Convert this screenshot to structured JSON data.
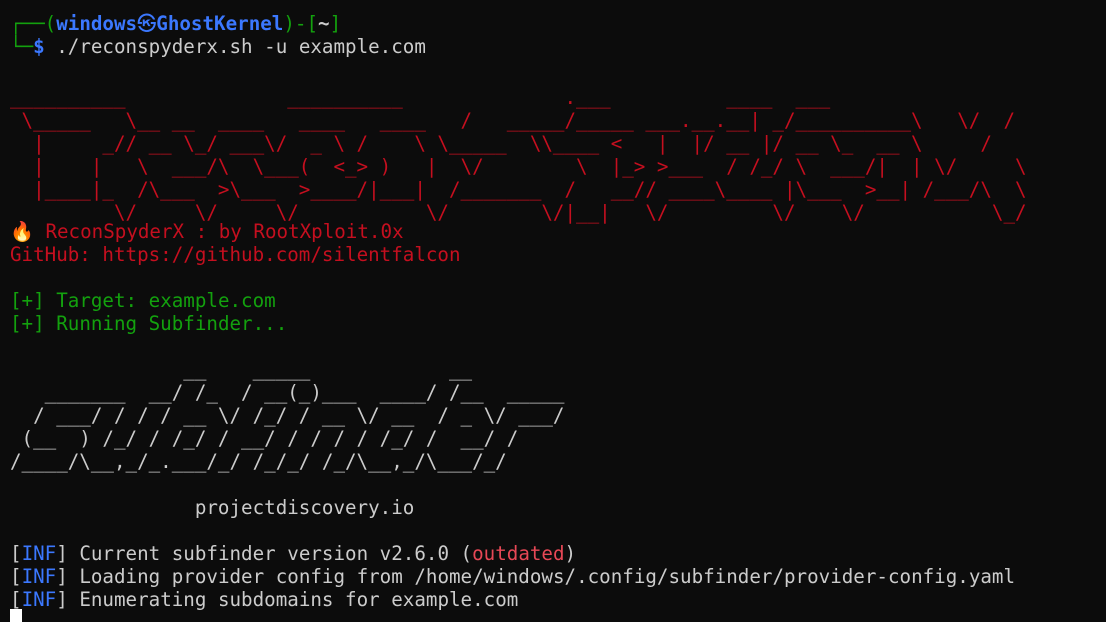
{
  "prompt": {
    "corner_top": "┌──(",
    "user": "windows",
    "at_symbol": "㉿",
    "host": "GhostKernel",
    "mid": ")-[",
    "path": "~",
    "end": "]",
    "corner_bottom": "└─",
    "dollar": "$",
    "command": " ./reconspyderx.sh -u example.com"
  },
  "banner": {
    "lines": [
      "__________              __________              .___          ____  ___",
      " \\_____   \\__ __  ____   ____   ____   /   _____/_____ ___.__.__| _/__________\\   \\/  /",
      "  |     _// __ \\_/ ___\\/  _ \\ /    \\ \\_____  \\\\____ <   |  |/ __ |/ __ \\_  __ \\     /",
      "  |    |   \\  ___/\\  \\___(  <_> )   |  \\/        \\  |_> >___  / /_/ \\  ___/|  | \\/     \\",
      "  |____|_  /\\___  >\\___  >____/|___|  /_______  /   __// ____\\____ |\\___  >__| /___/\\  \\",
      "         \\/     \\/     \\/           \\/        \\/|__|   \\/         \\/    \\/           \\_/"
    ],
    "fire_icon": "🔥",
    "credit": " ReconSpyderX : by RootXploit.0x",
    "github_label": "GitHub: ",
    "github_url": "https://github.com/silentfalcon"
  },
  "status": {
    "target_prefix": "[+] ",
    "target_label": "Target: ",
    "target_value": "example.com",
    "running_prefix": "[+] ",
    "running_text": "Running Subfinder..."
  },
  "subfinder_banner": {
    "lines": [
      "               __    _____            __",
      "   _______  __/ /_  / __(_)___  ____/ /__  _____",
      "  / ___/ / / / __ \\/ /_/ / __ \\/ __  / _ \\/ ___/",
      " (__  ) /_/ / /_/ / __/ / / / / /_/ /  __/ /",
      "/____/\\__,_/_.___/_/ /_/_/ /_/\\__,_/\\___/_/"
    ],
    "site": "                projectdiscovery.io"
  },
  "logs": [
    {
      "open": "[",
      "tag": "INF",
      "close": "]",
      "text": " Current subfinder version v2.6.0 (",
      "highlight": "outdated",
      "tail": ")"
    },
    {
      "open": "[",
      "tag": "INF",
      "close": "]",
      "text": " Loading provider config from /home/windows/.config/subfinder/provider-config.yaml",
      "highlight": "",
      "tail": ""
    },
    {
      "open": "[",
      "tag": "INF",
      "close": "]",
      "text": " Enumerating subdomains for example.com",
      "highlight": "",
      "tail": ""
    }
  ],
  "colors": {
    "background": "#0c0c0c",
    "banner_red": "#c50f1f",
    "prompt_blue": "#3b78ff",
    "prompt_green": "#13a10e",
    "text": "#cccccc",
    "outdated_red": "#e74856"
  }
}
